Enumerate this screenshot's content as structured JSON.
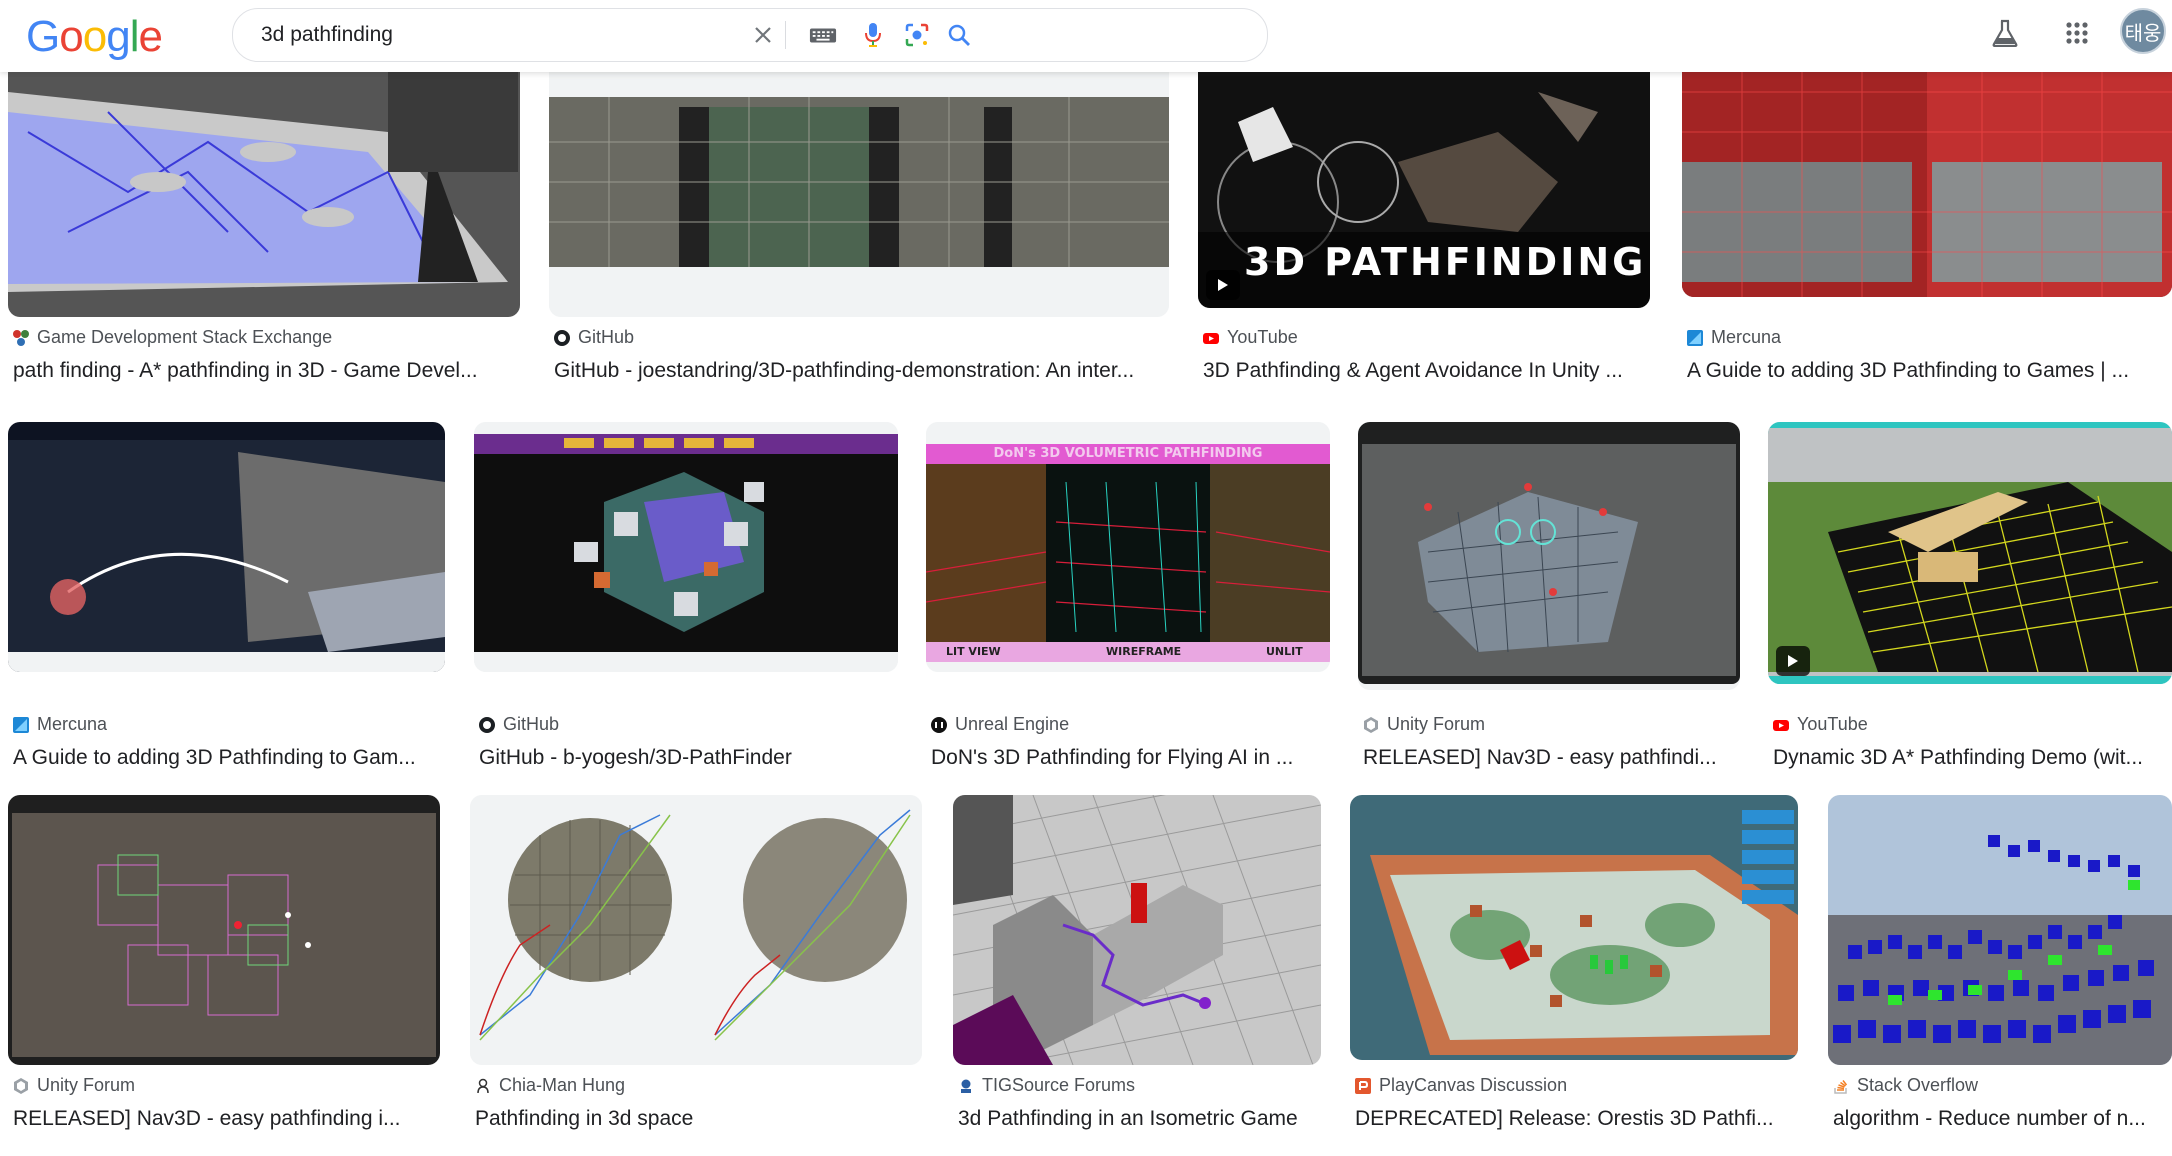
{
  "search": {
    "query": "3d pathfinding",
    "avatar": "태웅"
  },
  "logo": [
    "G",
    "o",
    "o",
    "g",
    "l",
    "e"
  ],
  "colors": {
    "blue": "#4285f4",
    "red": "#ea4335",
    "yellow": "#fbbc05",
    "green": "#34a853"
  },
  "icons": [
    "clear-icon",
    "keyboard-icon",
    "mic-icon",
    "lens-icon",
    "search-icon",
    "labs-icon",
    "apps-icon"
  ],
  "rows": [
    [
      {
        "source": "Game Development Stack Exchange",
        "title": "path finding - A* pathfinding in 3D - Game Devel...",
        "fav": "stackexchange-icon"
      },
      {
        "source": "GitHub",
        "title": "GitHub - joestandring/3D-pathfinding-demonstration: An inter...",
        "fav": "github-icon"
      },
      {
        "source": "YouTube",
        "title": "3D Pathfinding & Agent Avoidance In Unity ...",
        "fav": "youtube-icon",
        "overlay": "3D PATHFINDING"
      },
      {
        "source": "Mercuna",
        "title": "A Guide to adding 3D Pathfinding to Games | ...",
        "fav": "mercuna-icon"
      }
    ],
    [
      {
        "source": "Mercuna",
        "title": "A Guide to adding 3D Pathfinding to Gam...",
        "fav": "mercuna-icon"
      },
      {
        "source": "GitHub",
        "title": "GitHub - b-yogesh/3D-PathFinder",
        "fav": "github-icon"
      },
      {
        "source": "Unreal Engine",
        "title": "DoN's 3D Pathfinding for Flying AI in ...",
        "fav": "unreal-icon",
        "overlay": "DoN's 3D VOLUMETRIC PATHFINDING",
        "labels": [
          "LIT VIEW",
          "WIREFRAME",
          "UNLIT"
        ]
      },
      {
        "source": "Unity Forum",
        "title": "RELEASED] Nav3D - easy pathfindi...",
        "fav": "unity-icon"
      },
      {
        "source": "YouTube",
        "title": "Dynamic 3D A* Pathfinding Demo (wit...",
        "fav": "youtube-icon"
      }
    ],
    [
      {
        "source": "Unity Forum",
        "title": "RELEASED] Nav3D - easy pathfinding i...",
        "fav": "unity-icon"
      },
      {
        "source": "Chia-Man Hung",
        "title": "Pathfinding in 3d space",
        "fav": "person-icon"
      },
      {
        "source": "TIGSource Forums",
        "title": "3d Pathfinding in an Isometric Game",
        "fav": "tigsource-icon"
      },
      {
        "source": "PlayCanvas Discussion",
        "title": "DEPRECATED] Release: Orestis 3D Pathfi...",
        "fav": "playcanvas-icon"
      },
      {
        "source": "Stack Overflow",
        "title": "algorithm - Reduce number of n...",
        "fav": "stackoverflow-icon"
      }
    ]
  ]
}
